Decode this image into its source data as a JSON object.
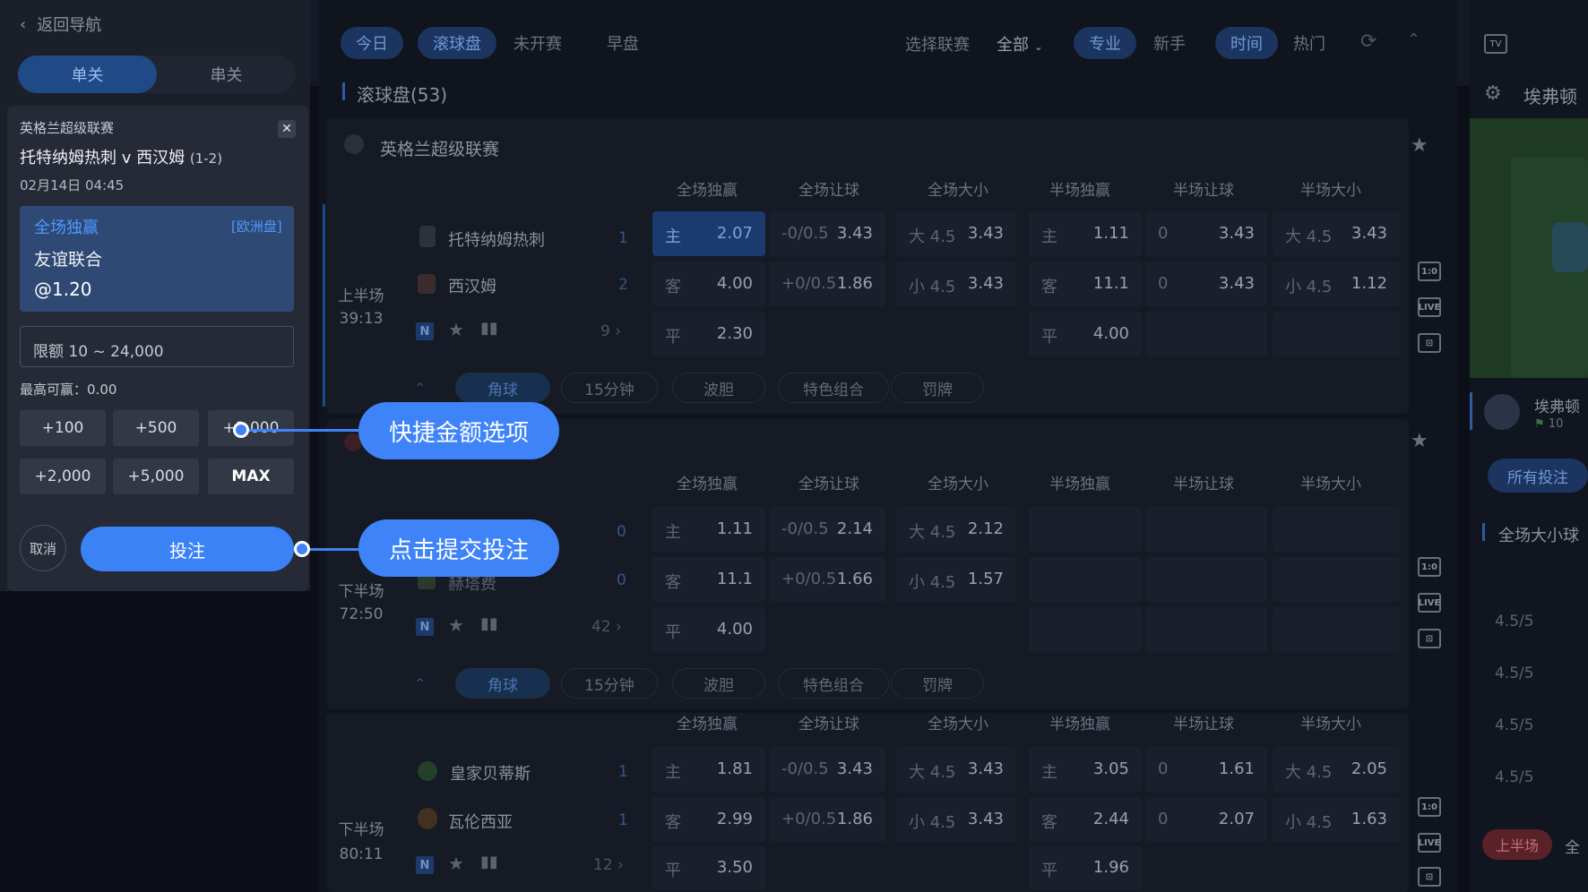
{
  "window": {
    "width": 1772,
    "height": 996
  },
  "nav": {
    "back_label": "返回导航",
    "modes": [
      {
        "label": "单关",
        "active": true
      },
      {
        "label": "串关",
        "active": false
      }
    ]
  },
  "bet_slip": {
    "league": "英格兰超级联赛",
    "match": "托特纳姆热刺 v 西汉姆",
    "score": "(1-2)",
    "datetime": "02月14日 04:45",
    "selection": {
      "market": "全场独赢",
      "odds_format": "[欧洲盘]",
      "team": "友谊联合",
      "odds": "@1.20"
    },
    "stake_placeholder": "限额 10 ~ 24,000",
    "max_win_label": "最高可赢：",
    "max_win_value": "0.00",
    "quick_amounts": [
      "+100",
      "+500",
      "+1,000",
      "+2,000",
      "+5,000",
      "MAX"
    ],
    "cancel_label": "取消",
    "submit_label": "投注"
  },
  "callouts": {
    "quick_amounts": "快捷金额选项",
    "submit": "点击提交投注"
  },
  "toolbar": {
    "date_tabs": [
      {
        "label": "今日",
        "active": true
      },
      {
        "label": "滚球盘",
        "active": true
      },
      {
        "label": "未开赛",
        "active": false
      },
      {
        "label": "早盘",
        "active": false
      }
    ],
    "league_filter_label": "选择联赛",
    "league_filter_value": "全部",
    "view_modes": [
      {
        "label": "专业",
        "active": true
      },
      {
        "label": "新手",
        "active": false
      }
    ],
    "sort_modes": [
      {
        "label": "时间",
        "active": true
      },
      {
        "label": "热门",
        "active": false
      }
    ]
  },
  "live_section": {
    "title": "滚球盘(53)"
  },
  "column_headers": [
    "全场独赢",
    "全场让球",
    "全场大小",
    "半场独赢",
    "半场让球",
    "半场大小"
  ],
  "market_tabs": [
    "角球",
    "15分钟",
    "波胆",
    "特色组合",
    "罚牌"
  ],
  "leagues": [
    {
      "name": "英格兰超级联赛",
      "match": {
        "period": "上半场",
        "clock": "39:13",
        "home": {
          "name": "托特纳姆热刺",
          "score": "1"
        },
        "away": {
          "name": "西汉姆",
          "score": "2"
        },
        "more_count": "9",
        "rows": [
          [
            "主",
            "2.07",
            "-0/0.5",
            "3.43",
            "大 4.5",
            "3.43",
            "主",
            "1.11",
            "0",
            "3.43",
            "大 4.5",
            "3.43"
          ],
          [
            "客",
            "4.00",
            "+0/0.5",
            "1.86",
            "小 4.5",
            "3.43",
            "客",
            "11.1",
            "0",
            "3.43",
            "小 4.5",
            "1.12"
          ],
          [
            "平",
            "2.30",
            "",
            "",
            "",
            "",
            "平",
            "4.00",
            "",
            "",
            "",
            ""
          ]
        ]
      }
    },
    {
      "name": "",
      "match": {
        "period": "下半场",
        "clock": "72:50",
        "home": {
          "name": "",
          "score": "0"
        },
        "away": {
          "name": "赫塔费",
          "score": "0"
        },
        "more_count": "42",
        "rows": [
          [
            "主",
            "1.11",
            "-0/0.5",
            "2.14",
            "大 4.5",
            "2.12",
            "",
            "",
            "",
            "",
            "",
            ""
          ],
          [
            "客",
            "11.1",
            "+0/0.5",
            "1.66",
            "小 4.5",
            "1.57",
            "",
            "",
            "",
            "",
            "",
            ""
          ],
          [
            "平",
            "4.00",
            "",
            "",
            "",
            "",
            "",
            "",
            "",
            "",
            "",
            ""
          ]
        ]
      }
    },
    {
      "name": "",
      "match": {
        "period": "下半场",
        "clock": "80:11",
        "home": {
          "name": "皇家贝蒂斯",
          "score": "1"
        },
        "away": {
          "name": "瓦伦西亚",
          "score": "1"
        },
        "more_count": "12",
        "rows": [
          [
            "主",
            "1.81",
            "-0/0.5",
            "3.43",
            "大 4.5",
            "3.43",
            "主",
            "3.05",
            "0",
            "1.61",
            "大 4.5",
            "2.05"
          ],
          [
            "客",
            "2.99",
            "+0/0.5",
            "1.86",
            "小 4.5",
            "3.43",
            "客",
            "2.44",
            "0",
            "2.07",
            "小 4.5",
            "1.63"
          ],
          [
            "平",
            "3.50",
            "",
            "",
            "",
            "",
            "平",
            "1.96",
            "",
            "",
            "",
            ""
          ]
        ]
      }
    }
  ],
  "side_icons": [
    "1:0",
    "LIVE",
    "⊡"
  ],
  "right_panel": {
    "team_header": "埃弗顿",
    "team_small": "埃弗顿",
    "team_small_count": "10",
    "all_bets_label": "所有投注",
    "market_title": "全场大小球",
    "lines": [
      "4.5/5",
      "4.5/5",
      "4.5/5",
      "4.5/5"
    ],
    "period_badge": "上半场",
    "period_next": "全"
  },
  "colors": {
    "accent": "#3f83f8",
    "slip_selection": "#2e4a74",
    "background": "#0c0f17"
  }
}
